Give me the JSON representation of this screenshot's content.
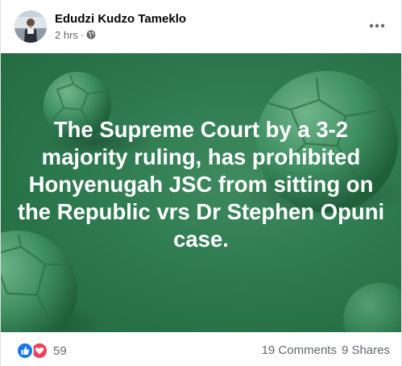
{
  "post": {
    "author": "Edudzi Kudzo Tameklo",
    "time": "2 hrs",
    "separator": "·",
    "privacy_icon": "globe-icon",
    "more_icon": "more-options-icon",
    "banner_text": "The Supreme Court by a 3-2 majority ruling, has prohibited Honyenugah JSC from sitting on the Republic vrs Dr Stephen Opuni case.",
    "banner_color": "#2e7a50",
    "text_color": "#ffffff"
  },
  "stats": {
    "reaction_icons": [
      "like-icon",
      "love-icon"
    ],
    "reaction_count": "59",
    "comments": "19 Comments",
    "shares": "9 Shares"
  },
  "colors": {
    "like": "#1877f2",
    "love": "#f33e58",
    "secondary_text": "#65676b"
  }
}
